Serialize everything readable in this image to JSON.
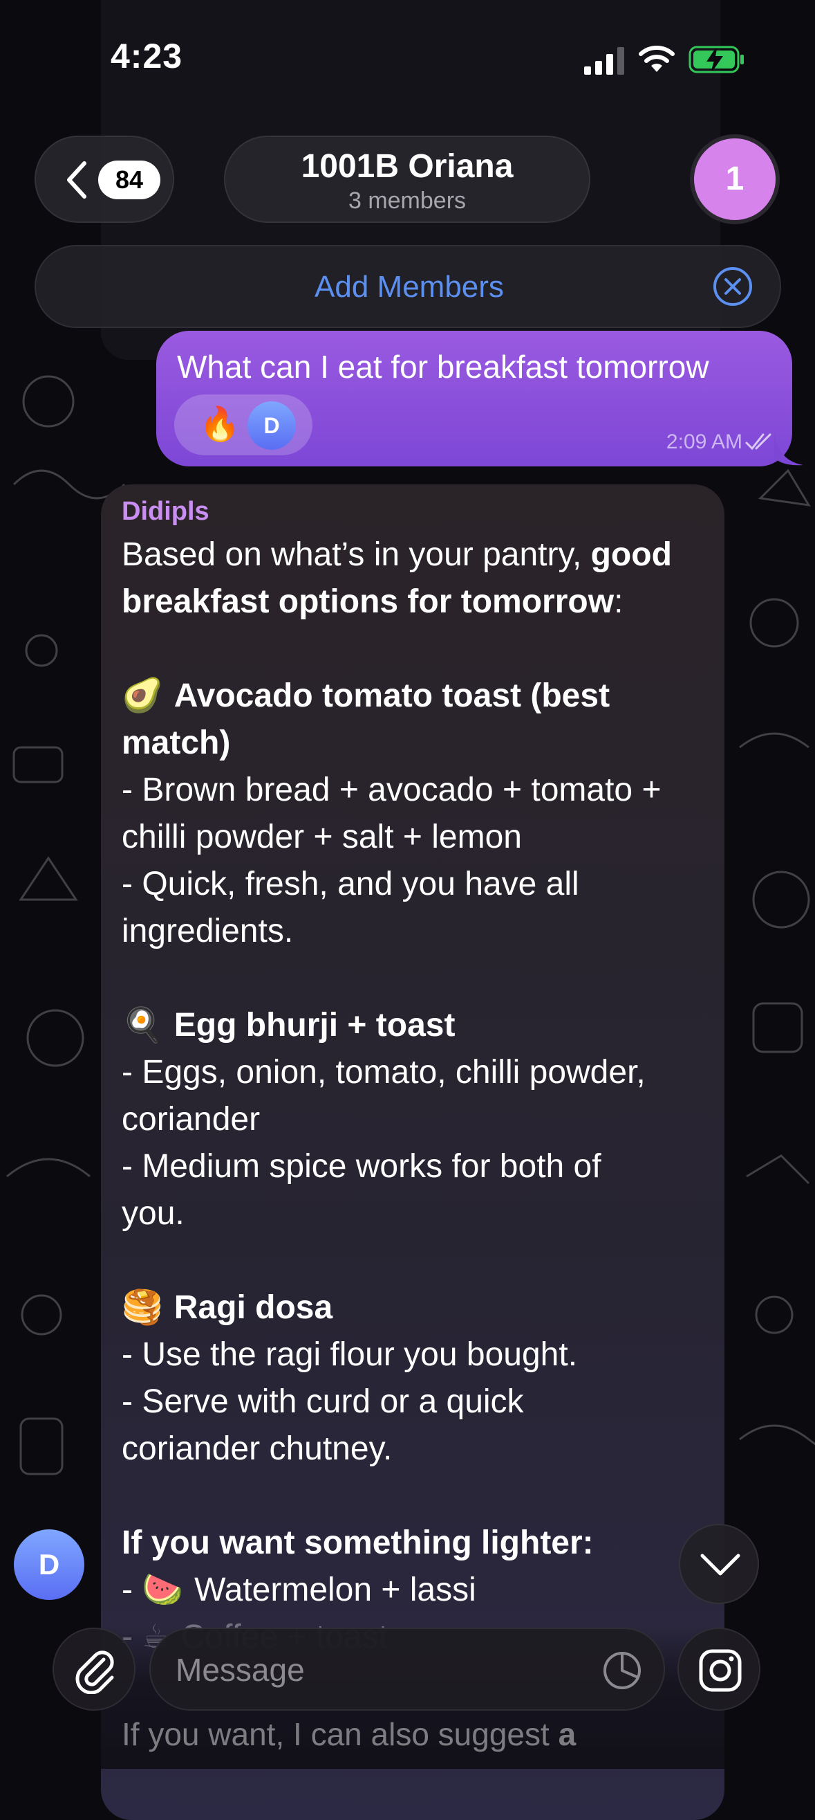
{
  "status_bar": {
    "time": "4:23"
  },
  "header": {
    "back_badge": "84",
    "title": "1001B Oriana",
    "subtitle": "3 members",
    "avatar_letter": "1",
    "avatar_color": "#d683ec"
  },
  "banner": {
    "add_members_label": "Add Members",
    "accent_color": "#5b8ff0"
  },
  "outgoing": {
    "text": "What can I eat for breakfast tomorrow",
    "reaction_emoji": "🔥",
    "reactor_initial": "D",
    "time": "2:09 AM",
    "bubble_color": "#8a4fdc"
  },
  "incoming": {
    "sender": "Didipls",
    "sender_color": "#c98ff0",
    "intro_a": "Based on what’s in your pantry, ",
    "intro_b": "good",
    "intro_c": "breakfast options for tomorrow",
    "intro_d": ":",
    "opt1_emoji": "🥑",
    "opt1_title_a": "Avocado tomato toast (best",
    "opt1_title_b": "match)",
    "opt1_l1": "- Brown bread + avocado + tomato +",
    "opt1_l2": "chilli powder + salt + lemon",
    "opt1_l3": "- Quick, fresh, and you have all",
    "opt1_l4": "ingredients.",
    "opt2_emoji": "🍳",
    "opt2_title": "Egg bhurji + toast",
    "opt2_l1": "- Eggs, onion, tomato, chilli powder,",
    "opt2_l2": "coriander",
    "opt2_l3": "- Medium spice works for both of",
    "opt2_l4": "you.",
    "opt3_emoji": "🥞",
    "opt3_title": "Ragi dosa",
    "opt3_l1": "- Use the ragi flour you bought.",
    "opt3_l2": "- Serve with curd or a quick",
    "opt3_l3": "coriander chutney.",
    "lighter_title": "If you want something lighter:",
    "lighter_prefix": "- ",
    "lighter_emoji": "🍉",
    "lighter_l1": "Watermelon + lassi",
    "lighter_l2_partial": "- ☕ Coffee + toast"
  },
  "overlay": {
    "sender_avatar_initial": "D",
    "message_placeholder": "Message",
    "peek_text_a": "If you want, I can also suggest ",
    "peek_text_b": "a"
  }
}
